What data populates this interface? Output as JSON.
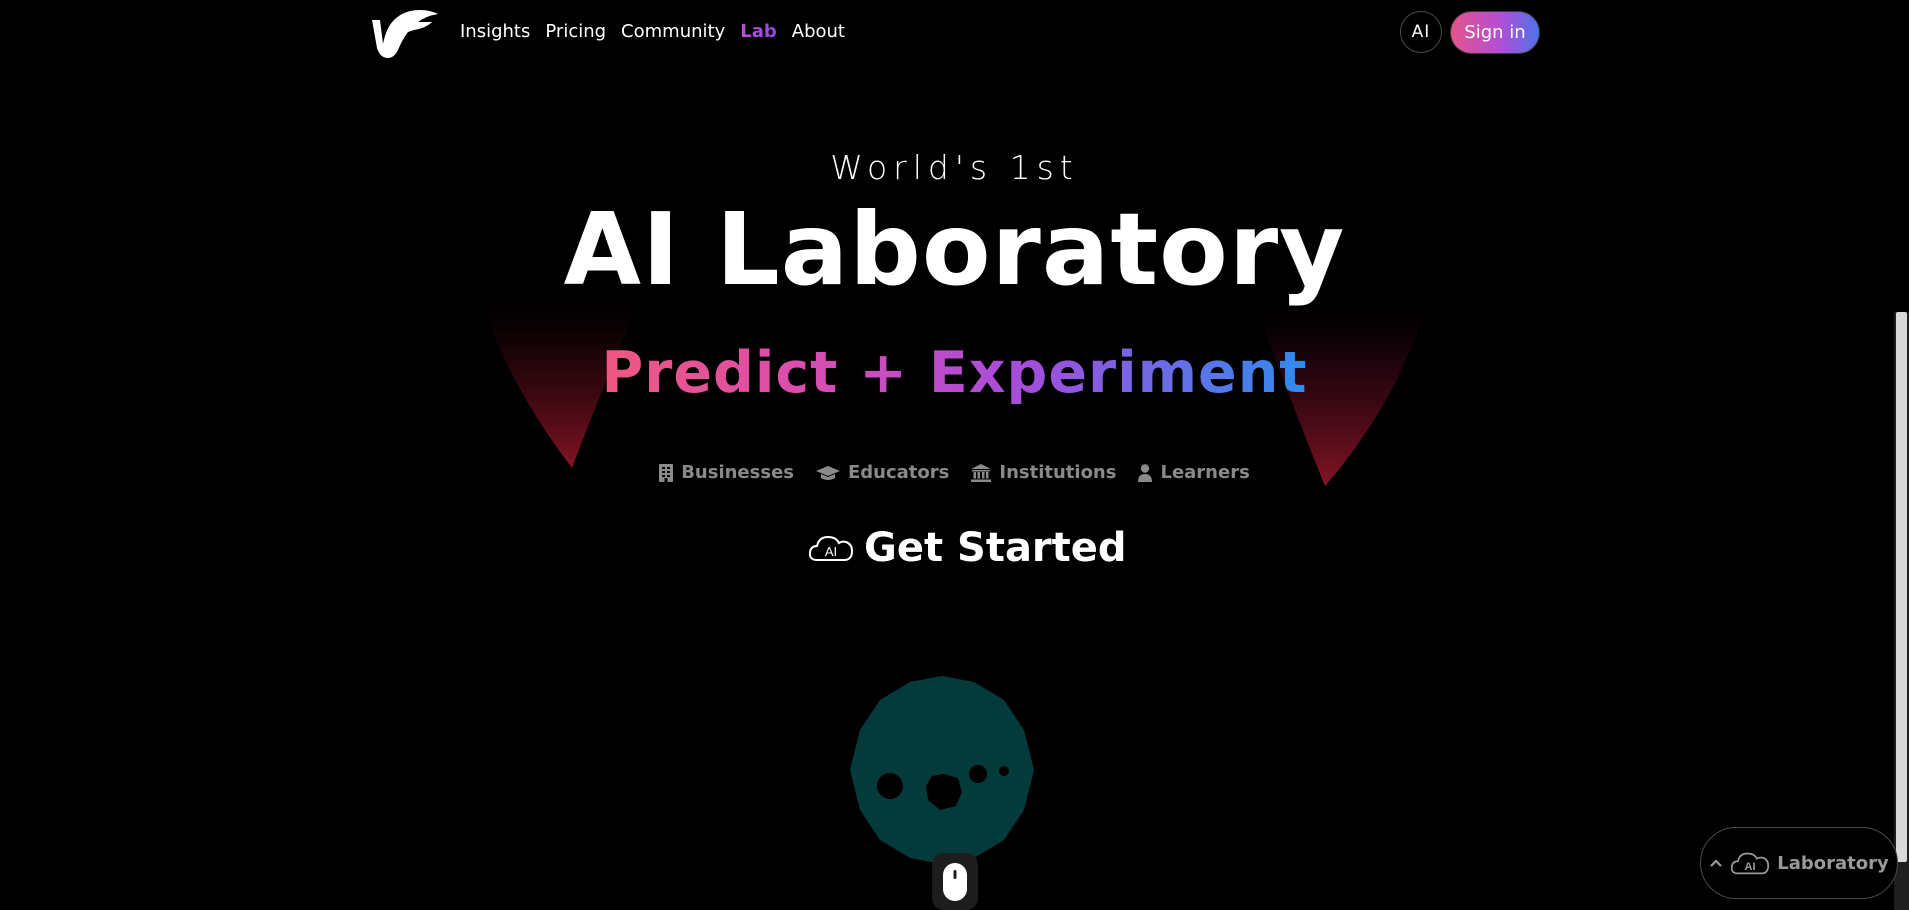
{
  "nav": {
    "logo_icon": "brand-logo-icon",
    "links": [
      {
        "label": "Insights"
      },
      {
        "label": "Pricing"
      },
      {
        "label": "Community"
      },
      {
        "label": "Lab"
      },
      {
        "label": "About"
      }
    ],
    "active_link": "Lab",
    "ai_button_label": "AI",
    "signin_label": "Sign in"
  },
  "hero": {
    "eyebrow": "World's 1st",
    "title": "AI Laboratory",
    "subtitle": "Predict + Experiment",
    "audiences": [
      {
        "label": "Businesses",
        "icon": "building-icon"
      },
      {
        "label": "Educators",
        "icon": "graduation-cap-icon"
      },
      {
        "label": "Institutions",
        "icon": "institution-icon"
      },
      {
        "label": "Learners",
        "icon": "user-icon"
      }
    ],
    "cta": {
      "label": "Get Started",
      "icon": "ai-cloud-icon",
      "icon_text": "AI"
    }
  },
  "widget": {
    "label": "Laboratory",
    "icon_text": "AI",
    "chevron_icon": "chevron-up-icon"
  },
  "colors": {
    "background": "#000000",
    "signin_gradient": [
      "#e5548a",
      "#b44ed4",
      "#4f72ea"
    ],
    "subtitle_gradient": [
      "#f0577f",
      "#d34cba",
      "#a54ddc",
      "#2f8cf0"
    ],
    "active_link": "#b44ed4",
    "planet": "#053a3a",
    "spotlight": "#c41d3a"
  }
}
